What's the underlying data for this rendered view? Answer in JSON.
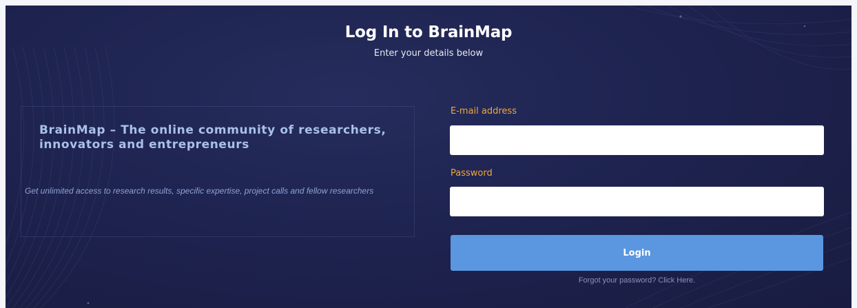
{
  "header": {
    "title": "Log In to BrainMap",
    "subtitle": "Enter your details below"
  },
  "intro": {
    "tagline": "BrainMap – The online community of researchers, innovators and entrepreneurs",
    "description": "Get unlimited access to research results, specific expertise, project calls and fellow researchers"
  },
  "form": {
    "email": {
      "label": "E-mail address",
      "value": "",
      "placeholder": ""
    },
    "password": {
      "label": "Password",
      "value": "",
      "placeholder": ""
    },
    "login_label": "Login",
    "forgot_label": "Forgot your password? Click Here."
  },
  "colors": {
    "background": "#1e2350",
    "accent_label": "#f0a63b",
    "button": "#5a97e0",
    "tagline": "#a9c0ea"
  }
}
